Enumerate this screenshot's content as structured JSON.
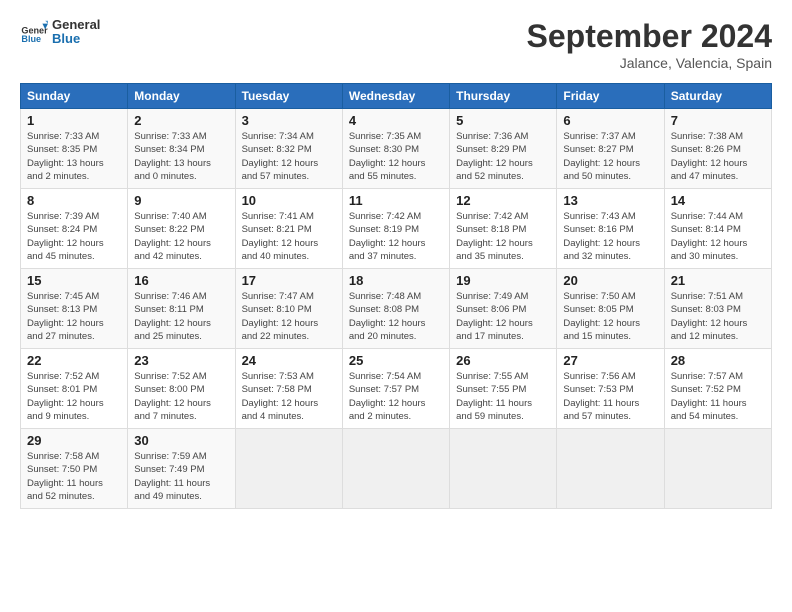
{
  "header": {
    "logo_general": "General",
    "logo_blue": "Blue",
    "month_title": "September 2024",
    "subtitle": "Jalance, Valencia, Spain"
  },
  "columns": [
    "Sunday",
    "Monday",
    "Tuesday",
    "Wednesday",
    "Thursday",
    "Friday",
    "Saturday"
  ],
  "rows": [
    [
      {
        "day": "1",
        "sunrise": "Sunrise: 7:33 AM",
        "sunset": "Sunset: 8:35 PM",
        "daylight": "Daylight: 13 hours and 2 minutes."
      },
      {
        "day": "2",
        "sunrise": "Sunrise: 7:33 AM",
        "sunset": "Sunset: 8:34 PM",
        "daylight": "Daylight: 13 hours and 0 minutes."
      },
      {
        "day": "3",
        "sunrise": "Sunrise: 7:34 AM",
        "sunset": "Sunset: 8:32 PM",
        "daylight": "Daylight: 12 hours and 57 minutes."
      },
      {
        "day": "4",
        "sunrise": "Sunrise: 7:35 AM",
        "sunset": "Sunset: 8:30 PM",
        "daylight": "Daylight: 12 hours and 55 minutes."
      },
      {
        "day": "5",
        "sunrise": "Sunrise: 7:36 AM",
        "sunset": "Sunset: 8:29 PM",
        "daylight": "Daylight: 12 hours and 52 minutes."
      },
      {
        "day": "6",
        "sunrise": "Sunrise: 7:37 AM",
        "sunset": "Sunset: 8:27 PM",
        "daylight": "Daylight: 12 hours and 50 minutes."
      },
      {
        "day": "7",
        "sunrise": "Sunrise: 7:38 AM",
        "sunset": "Sunset: 8:26 PM",
        "daylight": "Daylight: 12 hours and 47 minutes."
      }
    ],
    [
      {
        "day": "8",
        "sunrise": "Sunrise: 7:39 AM",
        "sunset": "Sunset: 8:24 PM",
        "daylight": "Daylight: 12 hours and 45 minutes."
      },
      {
        "day": "9",
        "sunrise": "Sunrise: 7:40 AM",
        "sunset": "Sunset: 8:22 PM",
        "daylight": "Daylight: 12 hours and 42 minutes."
      },
      {
        "day": "10",
        "sunrise": "Sunrise: 7:41 AM",
        "sunset": "Sunset: 8:21 PM",
        "daylight": "Daylight: 12 hours and 40 minutes."
      },
      {
        "day": "11",
        "sunrise": "Sunrise: 7:42 AM",
        "sunset": "Sunset: 8:19 PM",
        "daylight": "Daylight: 12 hours and 37 minutes."
      },
      {
        "day": "12",
        "sunrise": "Sunrise: 7:42 AM",
        "sunset": "Sunset: 8:18 PM",
        "daylight": "Daylight: 12 hours and 35 minutes."
      },
      {
        "day": "13",
        "sunrise": "Sunrise: 7:43 AM",
        "sunset": "Sunset: 8:16 PM",
        "daylight": "Daylight: 12 hours and 32 minutes."
      },
      {
        "day": "14",
        "sunrise": "Sunrise: 7:44 AM",
        "sunset": "Sunset: 8:14 PM",
        "daylight": "Daylight: 12 hours and 30 minutes."
      }
    ],
    [
      {
        "day": "15",
        "sunrise": "Sunrise: 7:45 AM",
        "sunset": "Sunset: 8:13 PM",
        "daylight": "Daylight: 12 hours and 27 minutes."
      },
      {
        "day": "16",
        "sunrise": "Sunrise: 7:46 AM",
        "sunset": "Sunset: 8:11 PM",
        "daylight": "Daylight: 12 hours and 25 minutes."
      },
      {
        "day": "17",
        "sunrise": "Sunrise: 7:47 AM",
        "sunset": "Sunset: 8:10 PM",
        "daylight": "Daylight: 12 hours and 22 minutes."
      },
      {
        "day": "18",
        "sunrise": "Sunrise: 7:48 AM",
        "sunset": "Sunset: 8:08 PM",
        "daylight": "Daylight: 12 hours and 20 minutes."
      },
      {
        "day": "19",
        "sunrise": "Sunrise: 7:49 AM",
        "sunset": "Sunset: 8:06 PM",
        "daylight": "Daylight: 12 hours and 17 minutes."
      },
      {
        "day": "20",
        "sunrise": "Sunrise: 7:50 AM",
        "sunset": "Sunset: 8:05 PM",
        "daylight": "Daylight: 12 hours and 15 minutes."
      },
      {
        "day": "21",
        "sunrise": "Sunrise: 7:51 AM",
        "sunset": "Sunset: 8:03 PM",
        "daylight": "Daylight: 12 hours and 12 minutes."
      }
    ],
    [
      {
        "day": "22",
        "sunrise": "Sunrise: 7:52 AM",
        "sunset": "Sunset: 8:01 PM",
        "daylight": "Daylight: 12 hours and 9 minutes."
      },
      {
        "day": "23",
        "sunrise": "Sunrise: 7:52 AM",
        "sunset": "Sunset: 8:00 PM",
        "daylight": "Daylight: 12 hours and 7 minutes."
      },
      {
        "day": "24",
        "sunrise": "Sunrise: 7:53 AM",
        "sunset": "Sunset: 7:58 PM",
        "daylight": "Daylight: 12 hours and 4 minutes."
      },
      {
        "day": "25",
        "sunrise": "Sunrise: 7:54 AM",
        "sunset": "Sunset: 7:57 PM",
        "daylight": "Daylight: 12 hours and 2 minutes."
      },
      {
        "day": "26",
        "sunrise": "Sunrise: 7:55 AM",
        "sunset": "Sunset: 7:55 PM",
        "daylight": "Daylight: 11 hours and 59 minutes."
      },
      {
        "day": "27",
        "sunrise": "Sunrise: 7:56 AM",
        "sunset": "Sunset: 7:53 PM",
        "daylight": "Daylight: 11 hours and 57 minutes."
      },
      {
        "day": "28",
        "sunrise": "Sunrise: 7:57 AM",
        "sunset": "Sunset: 7:52 PM",
        "daylight": "Daylight: 11 hours and 54 minutes."
      }
    ],
    [
      {
        "day": "29",
        "sunrise": "Sunrise: 7:58 AM",
        "sunset": "Sunset: 7:50 PM",
        "daylight": "Daylight: 11 hours and 52 minutes."
      },
      {
        "day": "30",
        "sunrise": "Sunrise: 7:59 AM",
        "sunset": "Sunset: 7:49 PM",
        "daylight": "Daylight: 11 hours and 49 minutes."
      },
      null,
      null,
      null,
      null,
      null
    ]
  ]
}
